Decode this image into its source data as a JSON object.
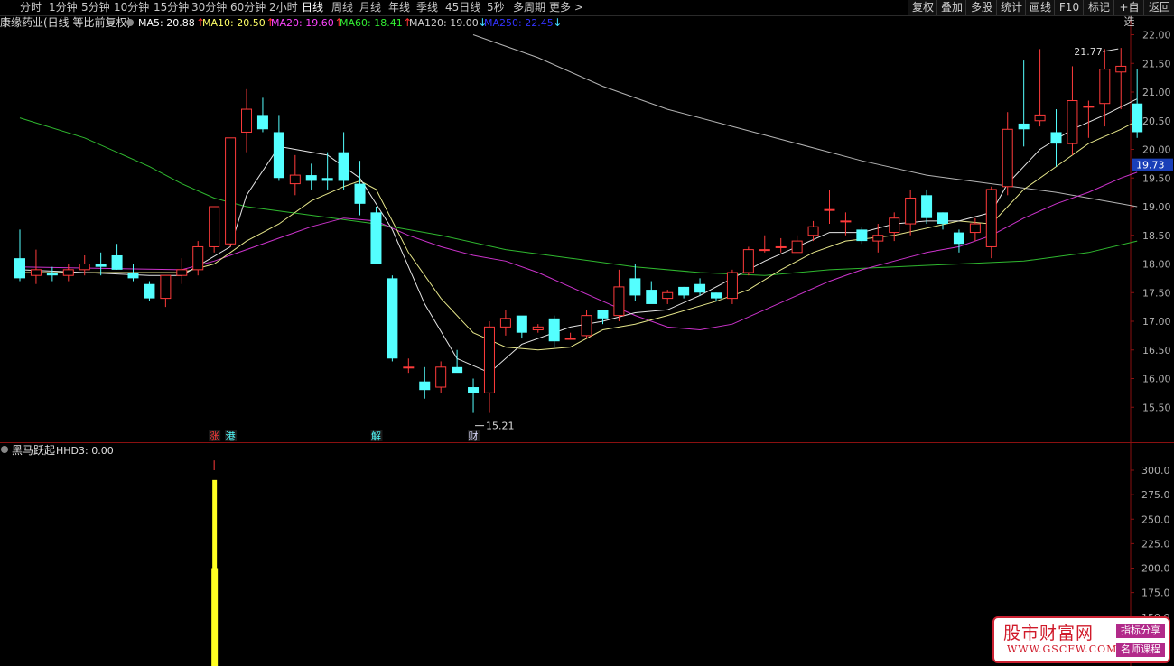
{
  "toolbar": {
    "periods": [
      "分时",
      "1分钟",
      "5分钟",
      "10分钟",
      "15分钟",
      "30分钟",
      "60分钟",
      "2小时",
      "日线",
      "周线",
      "月线",
      "年线",
      "季线",
      "45日线",
      "5秒",
      "多周期",
      "更多 >"
    ],
    "active_period": "日线",
    "right_buttons": [
      "复权",
      "叠加",
      "多股",
      "统计",
      "画线",
      "F10",
      "标记",
      "+自选",
      "返回"
    ]
  },
  "header": {
    "stock_title": "康缘药业(日线 等比前复权)",
    "ma_legend": [
      {
        "label": "MA5: 20.88",
        "arrow": "↑",
        "color": "#ffffff",
        "arrow_color": "#ff3333"
      },
      {
        "label": "MA10: 20.50",
        "arrow": "↑",
        "color": "#ffff66",
        "arrow_color": "#ff3333"
      },
      {
        "label": "MA20: 19.60",
        "arrow": "↑",
        "color": "#ff44ff",
        "arrow_color": "#ff3333"
      },
      {
        "label": "MA60: 18.41",
        "arrow": "↑",
        "color": "#33ee33",
        "arrow_color": "#ff3333"
      },
      {
        "label": "MA120: 19.00",
        "arrow": "↓",
        "color": "#d0d0d0",
        "arrow_color": "#44ddff"
      },
      {
        "label": "MA250: 22.45",
        "arrow": "↓",
        "color": "#3333ff",
        "arrow_color": "#44ddff"
      }
    ]
  },
  "chart_data": {
    "type": "candlestick",
    "price_axis": {
      "ticks": [
        "22.00",
        "21.50",
        "21.00",
        "20.50",
        "20.00",
        "19.50",
        "19.00",
        "18.50",
        "18.00",
        "17.50",
        "17.00",
        "16.50",
        "16.00",
        "15.50"
      ],
      "range": [
        15.0,
        22.25
      ]
    },
    "current_price": "19.73",
    "high_label": "21.77",
    "low_label": "15.21",
    "colors": {
      "up": "#ff3b3b",
      "down": "#54ffff",
      "ma5": "#e6e6e6",
      "ma10": "#e6e68a",
      "ma20": "#cc33cc",
      "ma60": "#2fb82f",
      "ma120": "#b4b4b4"
    },
    "candles": [
      [
        18.1,
        18.6,
        17.7,
        17.75
      ],
      [
        17.8,
        18.25,
        17.65,
        17.9
      ],
      [
        17.85,
        17.95,
        17.7,
        17.8
      ],
      [
        17.8,
        18.0,
        17.7,
        17.9
      ],
      [
        17.9,
        18.15,
        17.8,
        18.0
      ],
      [
        18.0,
        18.2,
        17.8,
        17.95
      ],
      [
        18.15,
        18.35,
        17.9,
        17.9
      ],
      [
        17.85,
        18.0,
        17.7,
        17.75
      ],
      [
        17.65,
        17.7,
        17.35,
        17.4
      ],
      [
        17.4,
        17.8,
        17.25,
        17.8
      ],
      [
        17.8,
        18.1,
        17.65,
        17.9
      ],
      [
        17.9,
        18.4,
        17.8,
        18.3
      ],
      [
        18.3,
        18.95,
        18.2,
        19.0
      ],
      [
        18.35,
        20.2,
        18.3,
        20.2
      ],
      [
        20.3,
        21.05,
        19.95,
        20.7
      ],
      [
        20.6,
        20.9,
        20.3,
        20.35
      ],
      [
        20.3,
        20.6,
        19.45,
        19.5
      ],
      [
        19.4,
        19.9,
        19.2,
        19.55
      ],
      [
        19.55,
        19.75,
        19.3,
        19.45
      ],
      [
        19.5,
        19.95,
        19.3,
        19.45
      ],
      [
        19.95,
        20.3,
        19.3,
        19.45
      ],
      [
        19.4,
        19.8,
        18.85,
        19.05
      ],
      [
        18.9,
        19.0,
        18.05,
        18.0
      ],
      [
        17.75,
        17.8,
        16.3,
        16.35
      ],
      [
        16.2,
        16.35,
        16.1,
        16.2
      ],
      [
        15.95,
        16.2,
        15.65,
        15.8
      ],
      [
        15.85,
        16.3,
        15.75,
        16.2
      ],
      [
        16.2,
        16.5,
        16.15,
        16.1
      ],
      [
        15.85,
        16.0,
        15.4,
        15.75
      ],
      [
        15.75,
        17.0,
        15.4,
        16.9
      ],
      [
        16.9,
        17.2,
        16.75,
        17.05
      ],
      [
        17.1,
        17.05,
        16.7,
        16.8
      ],
      [
        16.85,
        16.95,
        16.8,
        16.9
      ],
      [
        17.05,
        17.1,
        16.55,
        16.65
      ],
      [
        16.7,
        16.8,
        16.7,
        16.7
      ],
      [
        16.75,
        17.2,
        16.7,
        17.1
      ],
      [
        17.2,
        17.2,
        16.95,
        17.05
      ],
      [
        17.1,
        17.9,
        17.0,
        17.6
      ],
      [
        17.75,
        18.0,
        17.35,
        17.45
      ],
      [
        17.55,
        17.7,
        17.4,
        17.3
      ],
      [
        17.4,
        17.55,
        17.3,
        17.5
      ],
      [
        17.6,
        17.6,
        17.4,
        17.45
      ],
      [
        17.65,
        17.75,
        17.45,
        17.5
      ],
      [
        17.5,
        17.5,
        17.35,
        17.4
      ],
      [
        17.4,
        17.9,
        17.3,
        17.85
      ],
      [
        17.85,
        18.3,
        17.8,
        18.25
      ],
      [
        18.25,
        18.5,
        18.2,
        18.25
      ],
      [
        18.3,
        18.45,
        18.2,
        18.3
      ],
      [
        18.2,
        18.5,
        18.2,
        18.4
      ],
      [
        18.5,
        18.75,
        18.4,
        18.65
      ],
      [
        18.95,
        19.3,
        18.7,
        18.95
      ],
      [
        18.75,
        18.9,
        18.5,
        18.75
      ],
      [
        18.6,
        18.65,
        18.35,
        18.4
      ],
      [
        18.4,
        18.7,
        18.2,
        18.5
      ],
      [
        18.55,
        18.9,
        18.4,
        18.8
      ],
      [
        18.7,
        19.3,
        18.5,
        19.15
      ],
      [
        19.2,
        19.3,
        18.7,
        18.8
      ],
      [
        18.9,
        18.9,
        18.6,
        18.7
      ],
      [
        18.55,
        18.6,
        18.2,
        18.35
      ],
      [
        18.55,
        18.8,
        18.4,
        18.7
      ],
      [
        18.3,
        19.35,
        18.1,
        19.3
      ],
      [
        19.35,
        20.65,
        19.2,
        20.35
      ],
      [
        20.45,
        21.55,
        20.05,
        20.35
      ],
      [
        20.5,
        21.75,
        20.4,
        20.6
      ],
      [
        20.3,
        20.7,
        19.7,
        20.1
      ],
      [
        20.1,
        21.45,
        19.9,
        20.85
      ],
      [
        20.75,
        20.85,
        20.2,
        20.75
      ],
      [
        20.8,
        21.75,
        20.4,
        21.4
      ],
      [
        21.35,
        21.77,
        20.7,
        21.45
      ],
      [
        20.8,
        21.4,
        20.2,
        20.3
      ]
    ],
    "markers": [
      {
        "text": "涨",
        "color": "#ff3b3b",
        "candle": 12
      },
      {
        "text": "港",
        "color": "#54ffff",
        "candle": 13
      },
      {
        "text": "解",
        "color": "#54ffff",
        "candle": 22
      },
      {
        "text": "财",
        "color": "#ddddff",
        "candle": 28
      }
    ],
    "ma_lines": {
      "ma5": [
        [
          0,
          17.9
        ],
        [
          8,
          17.8
        ],
        [
          10,
          17.8
        ],
        [
          13,
          18.3
        ],
        [
          14,
          19.2
        ],
        [
          16,
          20.05
        ],
        [
          17,
          20.0
        ],
        [
          19,
          19.9
        ],
        [
          21,
          19.5
        ],
        [
          23,
          18.6
        ],
        [
          25,
          17.3
        ],
        [
          27,
          16.35
        ],
        [
          29,
          16.1
        ],
        [
          31,
          16.6
        ],
        [
          34,
          16.9
        ],
        [
          36,
          17.0
        ],
        [
          38,
          17.15
        ],
        [
          40,
          17.2
        ],
        [
          42,
          17.45
        ],
        [
          44,
          17.75
        ],
        [
          46,
          18.05
        ],
        [
          48,
          18.3
        ],
        [
          50,
          18.55
        ],
        [
          52,
          18.55
        ],
        [
          54,
          18.7
        ],
        [
          56,
          18.75
        ],
        [
          58,
          18.75
        ],
        [
          60,
          18.9
        ],
        [
          61,
          19.4
        ],
        [
          63,
          20.0
        ],
        [
          65,
          20.35
        ],
        [
          67,
          20.6
        ],
        [
          69,
          20.88
        ]
      ],
      "ma10": [
        [
          0,
          17.85
        ],
        [
          10,
          17.85
        ],
        [
          12,
          18.0
        ],
        [
          14,
          18.4
        ],
        [
          16,
          18.7
        ],
        [
          18,
          19.1
        ],
        [
          20,
          19.35
        ],
        [
          21,
          19.45
        ],
        [
          22,
          19.3
        ],
        [
          24,
          18.2
        ],
        [
          26,
          17.4
        ],
        [
          28,
          16.8
        ],
        [
          30,
          16.55
        ],
        [
          32,
          16.5
        ],
        [
          34,
          16.55
        ],
        [
          36,
          16.85
        ],
        [
          38,
          16.95
        ],
        [
          40,
          17.1
        ],
        [
          43,
          17.35
        ],
        [
          45,
          17.55
        ],
        [
          47,
          17.9
        ],
        [
          49,
          18.2
        ],
        [
          51,
          18.4
        ],
        [
          54,
          18.5
        ],
        [
          58,
          18.75
        ],
        [
          60,
          18.7
        ],
        [
          62,
          19.3
        ],
        [
          64,
          19.7
        ],
        [
          66,
          20.1
        ],
        [
          68,
          20.35
        ],
        [
          69,
          20.5
        ]
      ],
      "ma20": [
        [
          0,
          17.95
        ],
        [
          10,
          17.9
        ],
        [
          12,
          18.05
        ],
        [
          14,
          18.25
        ],
        [
          16,
          18.45
        ],
        [
          18,
          18.65
        ],
        [
          20,
          18.8
        ],
        [
          22,
          18.75
        ],
        [
          24,
          18.5
        ],
        [
          26,
          18.3
        ],
        [
          28,
          18.15
        ],
        [
          30,
          18.05
        ],
        [
          32,
          17.85
        ],
        [
          34,
          17.6
        ],
        [
          36,
          17.35
        ],
        [
          38,
          17.1
        ],
        [
          40,
          16.9
        ],
        [
          42,
          16.85
        ],
        [
          44,
          16.95
        ],
        [
          46,
          17.2
        ],
        [
          48,
          17.45
        ],
        [
          50,
          17.7
        ],
        [
          52,
          17.9
        ],
        [
          54,
          18.05
        ],
        [
          56,
          18.2
        ],
        [
          58,
          18.3
        ],
        [
          60,
          18.5
        ],
        [
          62,
          18.8
        ],
        [
          64,
          19.05
        ],
        [
          66,
          19.25
        ],
        [
          68,
          19.5
        ],
        [
          69,
          19.6
        ]
      ],
      "ma60": [
        [
          0,
          20.55
        ],
        [
          4,
          20.2
        ],
        [
          8,
          19.7
        ],
        [
          10,
          19.4
        ],
        [
          12,
          19.15
        ],
        [
          14,
          19.0
        ],
        [
          18,
          18.85
        ],
        [
          22,
          18.7
        ],
        [
          26,
          18.5
        ],
        [
          30,
          18.25
        ],
        [
          34,
          18.1
        ],
        [
          38,
          17.95
        ],
        [
          42,
          17.85
        ],
        [
          46,
          17.8
        ],
        [
          50,
          17.9
        ],
        [
          54,
          17.95
        ],
        [
          58,
          18.0
        ],
        [
          62,
          18.05
        ],
        [
          66,
          18.2
        ],
        [
          69,
          18.4
        ]
      ],
      "ma120": [
        [
          28,
          22.0
        ],
        [
          32,
          21.6
        ],
        [
          36,
          21.1
        ],
        [
          40,
          20.7
        ],
        [
          44,
          20.4
        ],
        [
          48,
          20.1
        ],
        [
          52,
          19.8
        ],
        [
          56,
          19.55
        ],
        [
          60,
          19.4
        ],
        [
          64,
          19.25
        ],
        [
          68,
          19.05
        ],
        [
          69,
          19.0
        ]
      ]
    },
    "indicator": {
      "title": "黑马跃起",
      "value_label": "HHD3: 0.00",
      "axis_ticks": [
        "300.0",
        "275.0",
        "250.0",
        "225.0",
        "200.0",
        "175.0",
        "150.0"
      ],
      "range": [
        140,
        310
      ],
      "bar": {
        "candle": 12,
        "values": [
          300,
          290,
          200
        ]
      },
      "colors": {
        "bar": "#ffff22",
        "wick": "#ff3b3b"
      }
    }
  },
  "watermark": {
    "title": "股市财富网",
    "url": "WWW.GSCFW.COM",
    "tags": [
      "指标分享",
      "名师课程"
    ]
  }
}
